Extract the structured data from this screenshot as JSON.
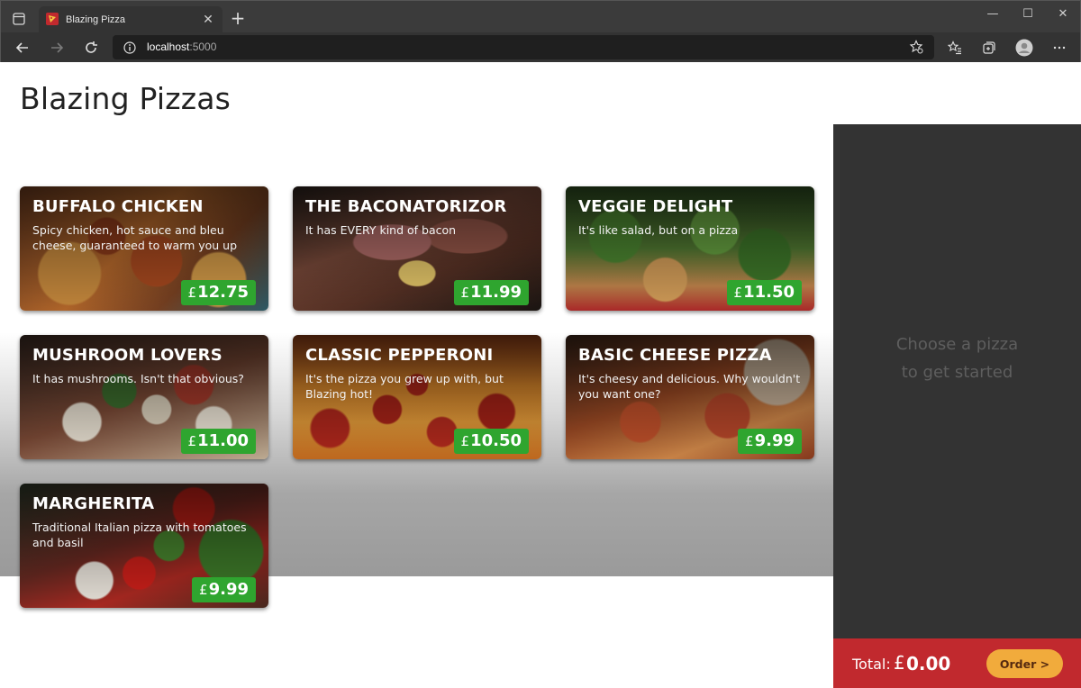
{
  "browser": {
    "tab_title": "Blazing Pizza",
    "tab_close": "✕",
    "new_tab": "+",
    "url_host": "localhost",
    "url_port": ":5000",
    "window_controls": [
      "—",
      "☐",
      "✕"
    ]
  },
  "page": {
    "title": "Blazing Pizzas"
  },
  "pizzas": [
    {
      "name": "BUFFALO CHICKEN",
      "description": "Spicy chicken, hot sauce and bleu cheese, guaranteed to warm you up",
      "currency": "£",
      "price": "12.75"
    },
    {
      "name": "THE BACONATORIZOR",
      "description": "It has EVERY kind of bacon",
      "currency": "£",
      "price": "11.99"
    },
    {
      "name": "VEGGIE DELIGHT",
      "description": "It's like salad, but on a pizza",
      "currency": "£",
      "price": "11.50"
    },
    {
      "name": "MUSHROOM LOVERS",
      "description": "It has mushrooms. Isn't that obvious?",
      "currency": "£",
      "price": "11.00"
    },
    {
      "name": "CLASSIC PEPPERONI",
      "description": "It's the pizza you grew up with, but Blazing hot!",
      "currency": "£",
      "price": "10.50"
    },
    {
      "name": "BASIC CHEESE PIZZA",
      "description": "It's cheesy and delicious. Why wouldn't you want one?",
      "currency": "£",
      "price": "9.99"
    },
    {
      "name": "MARGHERITA",
      "description": "Traditional Italian pizza with tomatoes and basil",
      "currency": "£",
      "price": "9.99"
    }
  ],
  "sidebar": {
    "empty_line1": "Choose a pizza",
    "empty_line2": "to get started"
  },
  "order": {
    "total_label": "Total:",
    "currency": "£",
    "total_value": "0.00",
    "button_label": "Order >"
  },
  "colors": {
    "price_badge": "#2fa52f",
    "sidebar_bg": "#333333",
    "order_bar": "#c1292e",
    "order_button": "#f1ab3c"
  }
}
